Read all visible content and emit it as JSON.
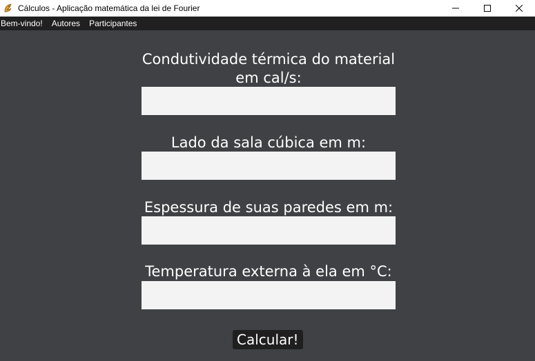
{
  "window": {
    "title": "Cálculos - Aplicação matemática da lei de Fourier",
    "icon": "python-feather-icon",
    "controls": [
      "minimize",
      "maximize",
      "close"
    ]
  },
  "menu": {
    "items": [
      {
        "label": "Bem-vindo!"
      },
      {
        "label": "Autores"
      },
      {
        "label": "Participantes"
      }
    ]
  },
  "form": {
    "fields": [
      {
        "label_line1": "Condutividade térmica do material",
        "label_line2": "em cal/s:",
        "value": ""
      },
      {
        "label_line1": "Lado da sala cúbica em m:",
        "value": ""
      },
      {
        "label_line1": "Espessura de suas paredes em m:",
        "value": ""
      },
      {
        "label_line1": "Temperatura externa à ela em °C:",
        "value": ""
      }
    ],
    "submit_label": "Calcular!"
  },
  "colors": {
    "background": "#3f4144",
    "menubar": "#202020",
    "input": "#f3f3f3",
    "button": "#1f1f1f",
    "text": "#ffffff"
  }
}
